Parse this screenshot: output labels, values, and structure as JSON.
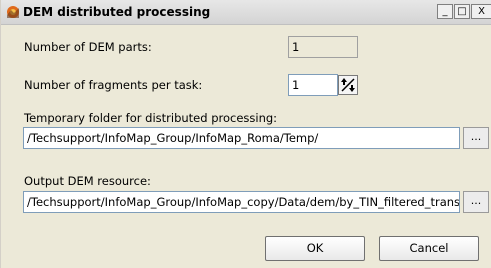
{
  "window": {
    "title": "DEM distributed processing",
    "controls": {
      "minimize": "_",
      "maximize": "□",
      "close": "X"
    }
  },
  "form": {
    "dem_parts": {
      "label": "Number of DEM parts:",
      "value": "1"
    },
    "fragments_per_task": {
      "label": "Number of fragments per task:",
      "value": "1"
    },
    "temp_folder": {
      "label": "Temporary folder for distributed processing:",
      "value": "/Techsupport/InfoMap_Group/InfoMap_Roma/Temp/",
      "browse_label": "..."
    },
    "output_resource": {
      "label": "Output DEM resource:",
      "value": "/Techsupport/InfoMap_Group/InfoMap_copy/Data/dem/by_TIN_filtered_trans_",
      "browse_label": "..."
    }
  },
  "buttons": {
    "ok": "OK",
    "cancel": "Cancel"
  },
  "icons": {
    "app": "dem-app-icon",
    "spin": "spin-arrows-icon"
  },
  "colors": {
    "window_bg": "#ece9d8",
    "field_border": "#7f9db9",
    "icon_orange": "#e06a1b"
  }
}
